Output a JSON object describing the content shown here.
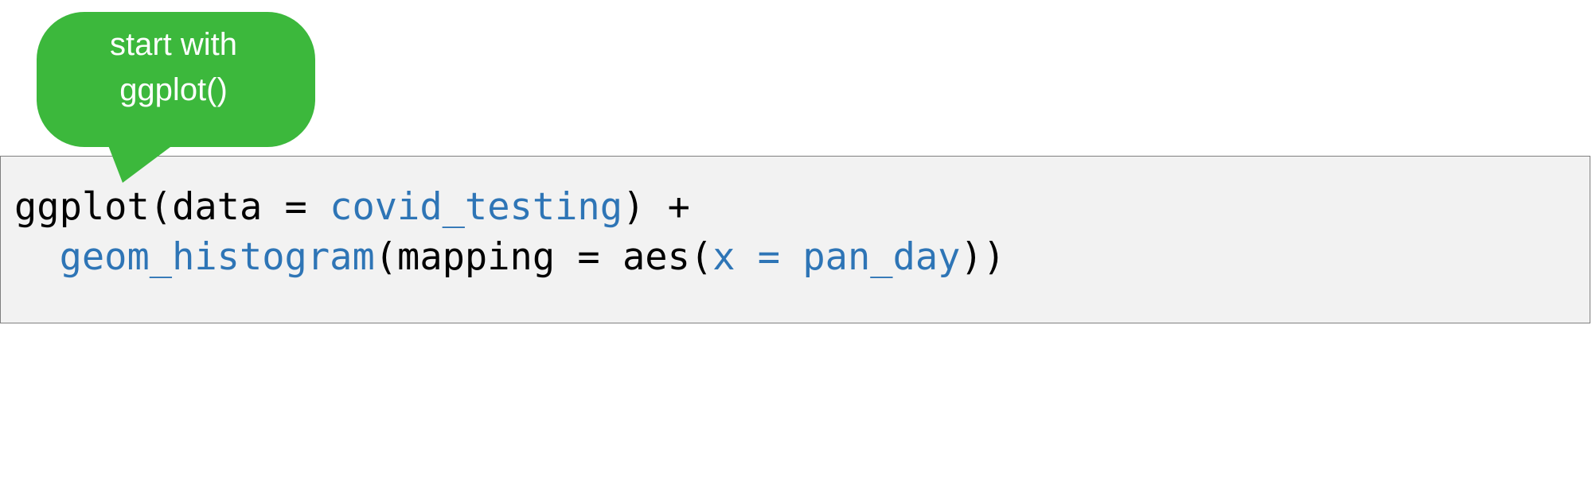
{
  "callout": {
    "line1": "start with",
    "line2": "ggplot()",
    "fill_color": "#3cb83c"
  },
  "code": {
    "line1": [
      {
        "text": "ggplot(data = ",
        "color": "black"
      },
      {
        "text": "covid_testing",
        "color": "blue"
      },
      {
        "text": ") +",
        "color": "black"
      }
    ],
    "line2": [
      {
        "text": "  ",
        "color": "black"
      },
      {
        "text": "geom_histogram",
        "color": "blue"
      },
      {
        "text": "(mapping = aes(",
        "color": "black"
      },
      {
        "text": "x = pan_day",
        "color": "blue"
      },
      {
        "text": "))",
        "color": "black"
      }
    ],
    "colors": {
      "black": "#000000",
      "blue": "#2e75b6",
      "panel_background": "#f2f2f2"
    }
  }
}
